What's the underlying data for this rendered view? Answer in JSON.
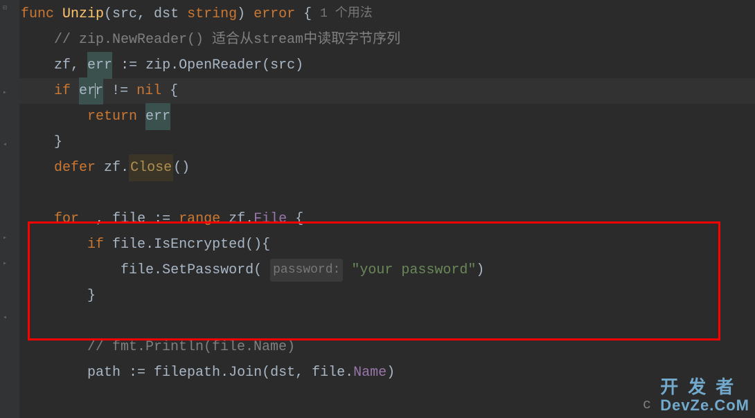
{
  "code": {
    "line1": {
      "func": "func",
      "name": "Unzip",
      "params": "(src, dst ",
      "type": "string",
      "paren_close": ") ",
      "return_type": "error",
      "brace": " {",
      "usage": "1 个用法"
    },
    "line2": {
      "indent": "    ",
      "comment": "// zip.NewReader() 适合从stream中读取字节序列"
    },
    "line3": {
      "indent": "    ",
      "v1": "zf",
      "comma": ", ",
      "v2": "err",
      "assign": " := ",
      "pkg": "zip",
      "dot": ".",
      "method": "OpenReader",
      "args": "(src)"
    },
    "line4": {
      "indent": "    ",
      "if": "if",
      "sp": " ",
      "err_pre": "er",
      "err_post": "r",
      "neq": " != ",
      "nil": "nil",
      "brace": " {"
    },
    "line5": {
      "indent": "        ",
      "return": "return",
      "sp": " ",
      "err": "err"
    },
    "line6": {
      "indent": "    ",
      "brace": "}"
    },
    "line7": {
      "indent": "    ",
      "defer": "defer",
      "sp": " ",
      "zf": "zf",
      "dot": ".",
      "close": "Close",
      "parens": "()"
    },
    "line8": {
      "indent": ""
    },
    "line9": {
      "indent": "    ",
      "for": "for",
      "sp": " ",
      "blank": "_",
      "comma": ", ",
      "file": "file",
      "assign": " := ",
      "range": "range",
      "sp2": " ",
      "zf": "zf",
      "dot": ".",
      "field": "File",
      "brace": " {"
    },
    "line10": {
      "indent": "        ",
      "if": "if",
      "sp": " ",
      "file": "file",
      "dot": ".",
      "method": "IsEncrypted",
      "parens": "(){"
    },
    "line11": {
      "indent": "            ",
      "file": "file",
      "dot": ".",
      "method": "SetPassword",
      "paren_open": "( ",
      "hint": "password:",
      "sp": " ",
      "str": "\"your password\"",
      "paren_close": ")"
    },
    "line12": {
      "indent": "        ",
      "brace": "}"
    },
    "line13": {
      "indent": ""
    },
    "line14": {
      "indent": "        ",
      "comment": "// fmt.Println(file.Name)"
    },
    "line15": {
      "indent": "        ",
      "path": "path",
      "assign": " := ",
      "pkg": "filepath",
      "dot": ".",
      "method": "Join",
      "args_open": "(",
      "dst": "dst",
      "comma": ", ",
      "file": "file",
      "dot2": ".",
      "name": "Name",
      "paren_close": ")"
    }
  },
  "watermark": {
    "cn": "开发者",
    "en": "DevZe.CoM"
  },
  "redbox": {
    "top": "320",
    "left": "40",
    "width": "1000",
    "height": "172"
  },
  "bottom_cut": "c"
}
